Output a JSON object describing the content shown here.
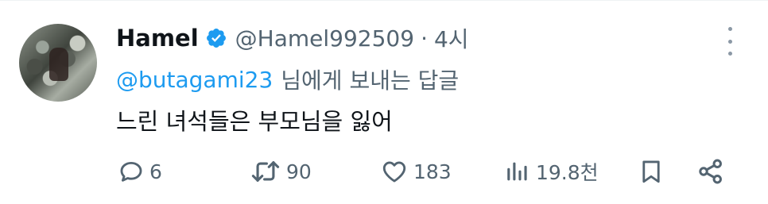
{
  "tweet": {
    "author_name": "Hamel",
    "handle": "@Hamel992509",
    "separator": "·",
    "time": "4시",
    "reply_to_handle": "@butagami23",
    "reply_to_suffix": "님에게 보내는 답글",
    "text": "느린 녀석들은 부모님을 잃어"
  },
  "actions": {
    "reply_count": "6",
    "retweet_count": "90",
    "like_count": "183",
    "views_count": "19.8천"
  },
  "colors": {
    "accent": "#1d9bf0",
    "secondary_text": "#536471",
    "primary_text": "#0f1419"
  },
  "icons": [
    "verified-badge-icon",
    "more-options-icon",
    "reply-icon",
    "retweet-icon",
    "like-icon",
    "views-icon",
    "bookmark-icon",
    "share-icon"
  ]
}
